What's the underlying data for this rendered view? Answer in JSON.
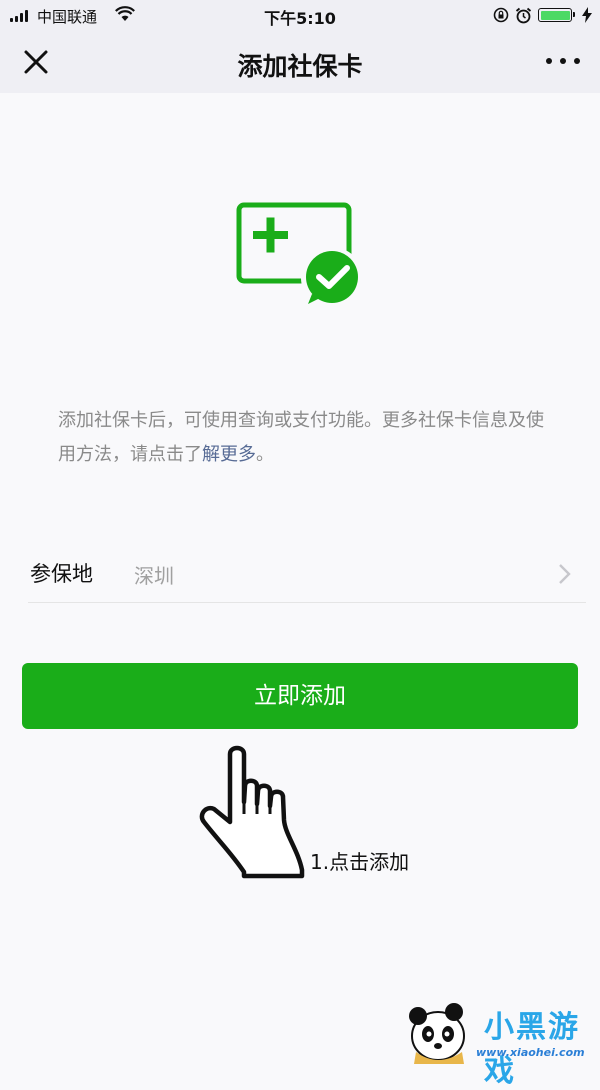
{
  "status_bar": {
    "carrier": "中国联通",
    "time": "下午5:10",
    "battery_level": 1.0
  },
  "nav": {
    "title": "添加社保卡"
  },
  "intro": {
    "text": "添加社保卡后，可使用查询或支付功能。更多社保卡信息及使用方法，请点击了",
    "link": "解更多",
    "end": "。"
  },
  "field": {
    "label": "参保地",
    "value": "深圳"
  },
  "button": {
    "label": "立即添加"
  },
  "annotation": {
    "text": "1.点击添加"
  },
  "watermark": {
    "brand": "小黑游戏",
    "url": "www.xiaohei.com"
  },
  "colors": {
    "accent_green": "#1aad19",
    "link_blue": "#576b95"
  },
  "icons": [
    "close-icon",
    "more-icon",
    "social-card-icon",
    "chevron-right-icon",
    "hand-pointer-icon",
    "signal-icon",
    "wifi-icon",
    "battery-icon",
    "alarm-icon",
    "lock-rotation-icon"
  ]
}
